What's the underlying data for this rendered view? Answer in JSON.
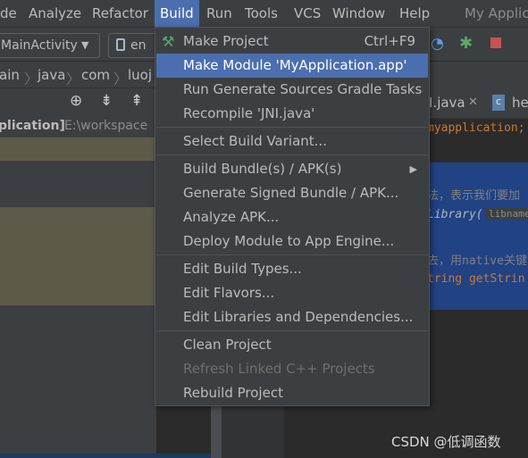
{
  "menubar": {
    "items": [
      "de",
      "Analyze",
      "Refactor",
      "Build",
      "Run",
      "Tools",
      "VCS",
      "Window",
      "Help"
    ],
    "app_title": "My Applic"
  },
  "toolbar": {
    "run_config": "MainActivity",
    "device_combo": "en"
  },
  "breadcrumb": [
    "ain",
    "java",
    "com",
    "luoj"
  ],
  "project": {
    "row_title": "plication]",
    "row_path": "E:\\workspace"
  },
  "editor": {
    "tabs": [
      "I.java",
      "he"
    ],
    "lines": [
      "myapplication;",
      "法，表示我们要加",
      "Library(",
      "libname",
      "去，用native关键",
      "tring getStrin"
    ]
  },
  "build_menu": {
    "items": [
      {
        "label": "Make Project",
        "shortcut": "Ctrl+F9",
        "icon": "hammer-icon"
      },
      {
        "label": "Make Module 'MyApplication.app'",
        "selected": true
      },
      {
        "label": "Run Generate Sources Gradle Tasks"
      },
      {
        "label": "Recompile 'JNI.java'"
      },
      {
        "label": "Select Build Variant..."
      },
      {
        "label": "Build Bundle(s) / APK(s)",
        "submenu": true
      },
      {
        "label": "Generate Signed Bundle / APK..."
      },
      {
        "label": "Analyze APK..."
      },
      {
        "label": "Deploy Module to App Engine..."
      },
      {
        "label": "Edit Build Types..."
      },
      {
        "label": "Edit Flavors..."
      },
      {
        "label": "Edit Libraries and Dependencies..."
      },
      {
        "label": "Clean Project"
      },
      {
        "label": "Refresh Linked C++ Projects",
        "disabled": true
      },
      {
        "label": "Rebuild Project"
      }
    ]
  },
  "watermark": "CSDN @低调函数",
  "colors": {
    "menu_bg": "#3c3f41",
    "selection": "#4b6eaf",
    "editor_bg": "#2b2b2b",
    "code_selection": "#214283"
  }
}
